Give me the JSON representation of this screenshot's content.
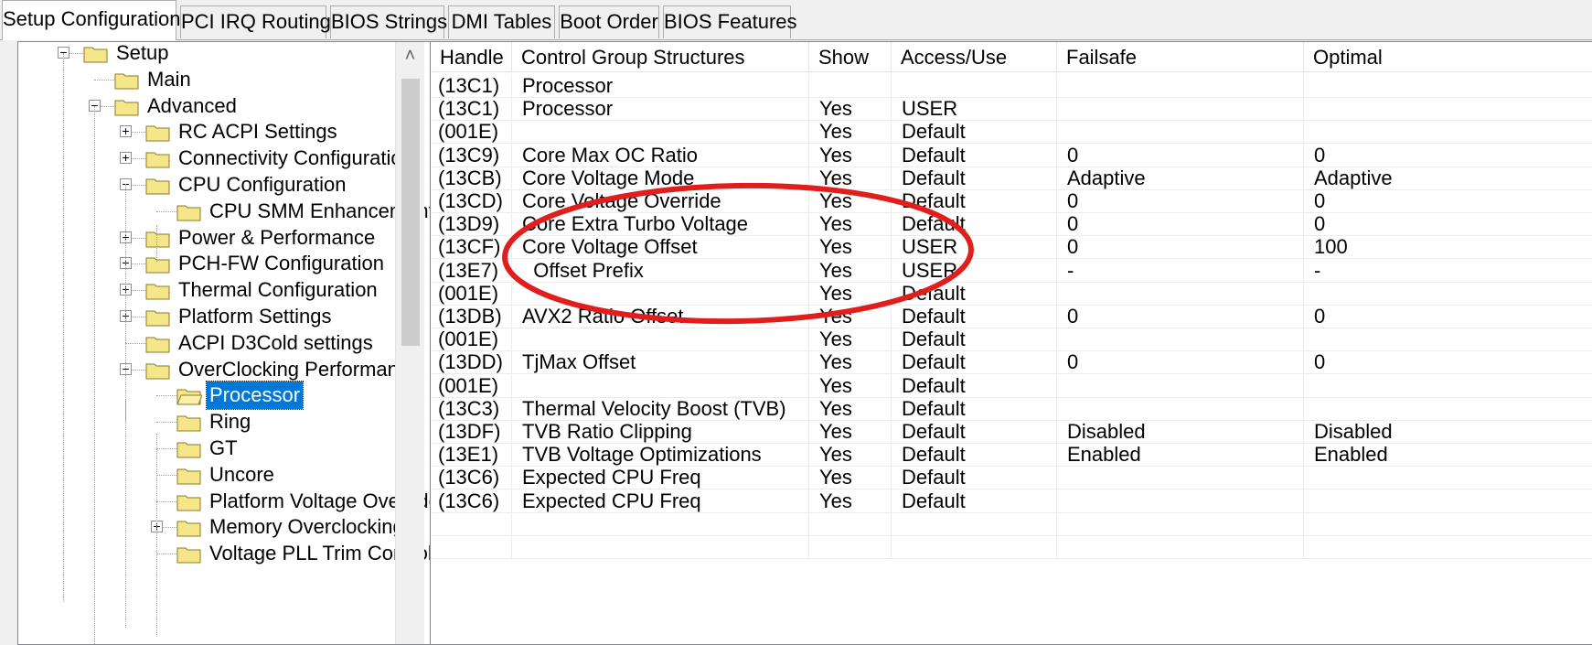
{
  "tabs": [
    {
      "label": "Setup Configuration",
      "active": true
    },
    {
      "label": "PCI IRQ Routing",
      "active": false
    },
    {
      "label": "BIOS Strings",
      "active": false
    },
    {
      "label": "DMI Tables",
      "active": false
    },
    {
      "label": "Boot Order",
      "active": false
    },
    {
      "label": "BIOS Features",
      "active": false
    }
  ],
  "tree": {
    "nodes": [
      {
        "label": "Setup",
        "expander": "minus"
      },
      {
        "label": "Main",
        "expander": null
      },
      {
        "label": "Advanced",
        "expander": "minus"
      },
      {
        "label": "RC ACPI Settings",
        "expander": "plus"
      },
      {
        "label": "Connectivity Configuration",
        "expander": "plus"
      },
      {
        "label": "CPU Configuration",
        "expander": "minus"
      },
      {
        "label": "CPU SMM Enhancement",
        "expander": null
      },
      {
        "label": "Power & Performance",
        "expander": "plus"
      },
      {
        "label": "PCH-FW Configuration",
        "expander": "plus"
      },
      {
        "label": "Thermal Configuration",
        "expander": "plus"
      },
      {
        "label": "Platform Settings",
        "expander": "plus"
      },
      {
        "label": "ACPI D3Cold settings",
        "expander": null
      },
      {
        "label": "OverClocking Performance",
        "expander": "minus"
      },
      {
        "label": "Processor",
        "expander": null,
        "selected": true
      },
      {
        "label": "Ring",
        "expander": null
      },
      {
        "label": "GT",
        "expander": null
      },
      {
        "label": "Uncore",
        "expander": null
      },
      {
        "label": "Platform Voltage Overrides",
        "expander": null
      },
      {
        "label": "Memory Overclocking",
        "expander": "plus"
      },
      {
        "label": "Voltage PLL Trim Controls",
        "expander": null
      }
    ]
  },
  "grid": {
    "columns": [
      "Handle",
      "Control Group Structures",
      "Show",
      "Access/Use",
      "Failsafe",
      "Optimal"
    ],
    "rows": [
      [
        "(13C1)",
        "Processor",
        "",
        "",
        "",
        ""
      ],
      [
        "(13C1)",
        "Processor",
        "Yes",
        "USER",
        "",
        ""
      ],
      [
        "(001E)",
        "",
        "Yes",
        "Default",
        "",
        ""
      ],
      [
        "(13C9)",
        "Core Max OC Ratio",
        "Yes",
        "Default",
        "0",
        "0"
      ],
      [
        "(13CB)",
        "Core Voltage Mode",
        "Yes",
        "Default",
        "Adaptive",
        "Adaptive"
      ],
      [
        "(13CD)",
        "Core Voltage Override",
        "Yes",
        "Default",
        "0",
        "0"
      ],
      [
        "(13D9)",
        "Core Extra Turbo Voltage",
        "Yes",
        "Default",
        "0",
        "0"
      ],
      [
        "(13CF)",
        "Core Voltage Offset",
        "Yes",
        "USER",
        "0",
        "100"
      ],
      [
        "(13E7)",
        "  Offset Prefix",
        "Yes",
        "USER",
        "-",
        "-"
      ],
      [
        "(001E)",
        "",
        "Yes",
        "Default",
        "",
        ""
      ],
      [
        "(13DB)",
        "AVX2 Ratio Offset",
        "Yes",
        "Default",
        "0",
        "0"
      ],
      [
        "(001E)",
        "",
        "Yes",
        "Default",
        "",
        ""
      ],
      [
        "(13DD)",
        "TjMax Offset",
        "Yes",
        "Default",
        "0",
        "0"
      ],
      [
        "(001E)",
        "",
        "Yes",
        "Default",
        "",
        ""
      ],
      [
        "(13C3)",
        "Thermal Velocity Boost (TVB)",
        "Yes",
        "Default",
        "",
        ""
      ],
      [
        "(13DF)",
        "TVB Ratio Clipping",
        "Yes",
        "Default",
        "Disabled",
        "Disabled"
      ],
      [
        "(13E1)",
        "TVB Voltage Optimizations",
        "Yes",
        "Default",
        "Enabled",
        "Enabled"
      ],
      [
        "(13C6)",
        "Expected CPU Freq",
        "Yes",
        "Default",
        "",
        ""
      ],
      [
        "(13C6)",
        "Expected CPU Freq",
        "Yes",
        "Default",
        "",
        ""
      ],
      [
        "",
        "",
        "",
        "",
        "",
        ""
      ],
      [
        "",
        "",
        "",
        "",
        "",
        ""
      ]
    ]
  },
  "colors": {
    "selection": "#0078d7",
    "annotation": "#e01e1e",
    "folder": "#f5e68a"
  },
  "icons": {
    "folder": "folder-icon",
    "scroll_up": "chevron-up-icon"
  }
}
